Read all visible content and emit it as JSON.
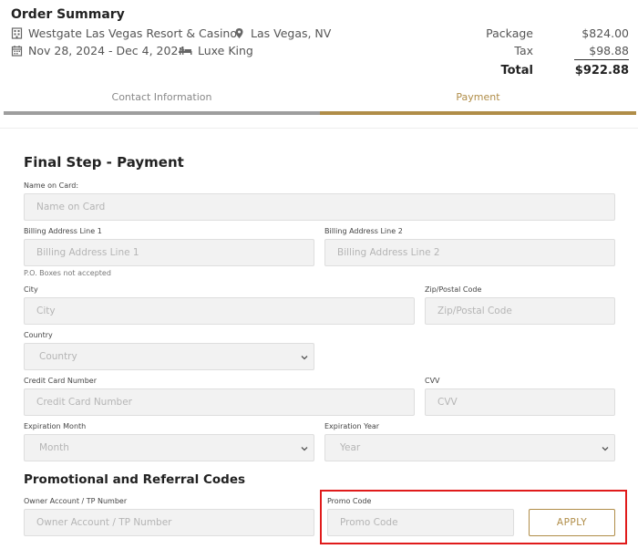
{
  "summary": {
    "title": "Order Summary",
    "hotel": "Westgate Las Vegas Resort & Casino",
    "location": "Las Vegas, NV",
    "dates": "Nov 28, 2024 - Dec 4, 2024",
    "room": "Luxe King",
    "package_label": "Package",
    "package_value": "$824.00",
    "tax_label": "Tax",
    "tax_value": "$98.88",
    "total_label": "Total",
    "total_value": "$922.88"
  },
  "tabs": {
    "contact": "Contact Information",
    "payment": "Payment"
  },
  "form": {
    "title": "Final Step - Payment",
    "name_label": "Name on Card:",
    "name_placeholder": "Name on Card",
    "addr1_label": "Billing Address Line 1",
    "addr1_placeholder": "Billing Address Line 1",
    "addr2_label": "Billing Address Line 2",
    "addr2_placeholder": "Billing Address Line 2",
    "po_note": "P.O. Boxes not accepted",
    "city_label": "City",
    "city_placeholder": "City",
    "zip_label": "Zip/Postal Code",
    "zip_placeholder": "Zip/Postal Code",
    "country_label": "Country",
    "country_value": "Country",
    "cc_label": "Credit Card Number",
    "cc_placeholder": "Credit Card Number",
    "cvv_label": "CVV",
    "cvv_placeholder": "CVV",
    "month_label": "Expiration Month",
    "month_value": "Month",
    "year_label": "Expiration Year",
    "year_value": "Year"
  },
  "promo": {
    "title": "Promotional and Referral Codes",
    "owner_label": "Owner Account / TP Number",
    "owner_placeholder": "Owner Account / TP Number",
    "code_label": "Promo Code",
    "code_placeholder": "Promo Code",
    "apply_label": "APPLY"
  },
  "colors": {
    "accent": "#b08d48",
    "inactive_tab": "#9e9e9e",
    "highlight": "#e01b1b"
  }
}
